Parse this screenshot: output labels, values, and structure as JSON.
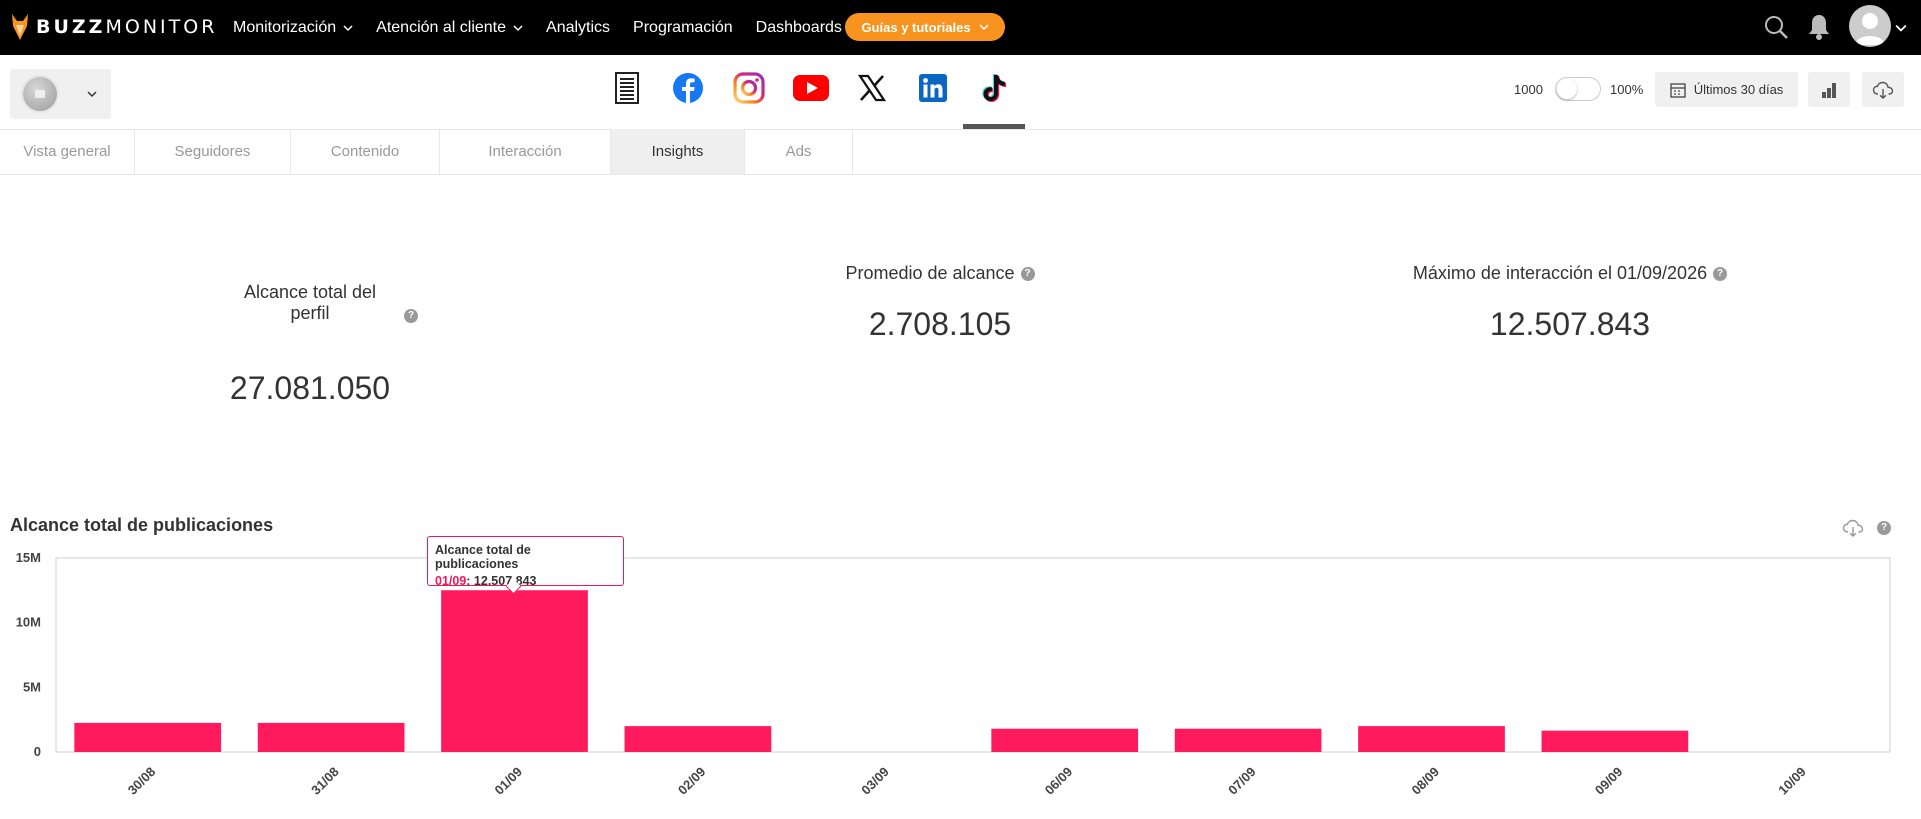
{
  "brand": {
    "logo_bold": "BUZZ",
    "logo_light": "MONITOR"
  },
  "nav": {
    "items": [
      {
        "label": "Monitorización",
        "dropdown": true
      },
      {
        "label": "Atención al cliente",
        "dropdown": true
      },
      {
        "label": "Analytics",
        "dropdown": false
      },
      {
        "label": "Programación",
        "dropdown": false
      },
      {
        "label": "Dashboards",
        "dropdown": false
      }
    ],
    "guide_button": "Guías y tutoriales"
  },
  "controls": {
    "value_1000": "1000",
    "value_percent": "100%",
    "date_range": "Últimos 30 días"
  },
  "networks": [
    "report-icon",
    "facebook-icon",
    "instagram-icon",
    "youtube-icon",
    "x-icon",
    "linkedin-icon",
    "tiktok-icon"
  ],
  "tabs": [
    {
      "label": "Vista general",
      "active": false
    },
    {
      "label": "Seguidores",
      "active": false
    },
    {
      "label": "Contenido",
      "active": false
    },
    {
      "label": "Interacción",
      "active": false
    },
    {
      "label": "Insights",
      "active": true
    },
    {
      "label": "Ads",
      "active": false
    }
  ],
  "kpis": {
    "total_reach": {
      "label_line1": "Alcance total del",
      "label_line2": "perfil",
      "value": "27.081.050"
    },
    "avg_reach": {
      "label": "Promedio de alcance",
      "value": "2.708.105"
    },
    "max_interaction": {
      "label": "Máximo de interacción el 01/09/2026",
      "value": "12.507.843"
    }
  },
  "chart_title": "Alcance total de publicaciones",
  "tooltip": {
    "title": "Alcance total de publicaciones",
    "date": "01/09",
    "value": ": 12.507.843"
  },
  "colors": {
    "bar": "#ff1a5e",
    "accent": "#f7931e",
    "topbar": "#000000"
  },
  "chart_data": {
    "type": "bar",
    "title": "Alcance total de publicaciones",
    "categories": [
      "30/08",
      "31/08",
      "01/09",
      "02/09",
      "03/09",
      "06/09",
      "07/09",
      "08/09",
      "09/09",
      "10/09"
    ],
    "values": [
      2250000,
      2250000,
      12507843,
      2000000,
      0,
      1800000,
      1800000,
      2000000,
      1650000,
      0
    ],
    "ylim": [
      0,
      15000000
    ],
    "yticks": [
      {
        "v": 0,
        "label": "0"
      },
      {
        "v": 5000000,
        "label": "5M"
      },
      {
        "v": 10000000,
        "label": "10M"
      },
      {
        "v": 15000000,
        "label": "15M"
      }
    ],
    "grid": false,
    "legend": "none"
  }
}
